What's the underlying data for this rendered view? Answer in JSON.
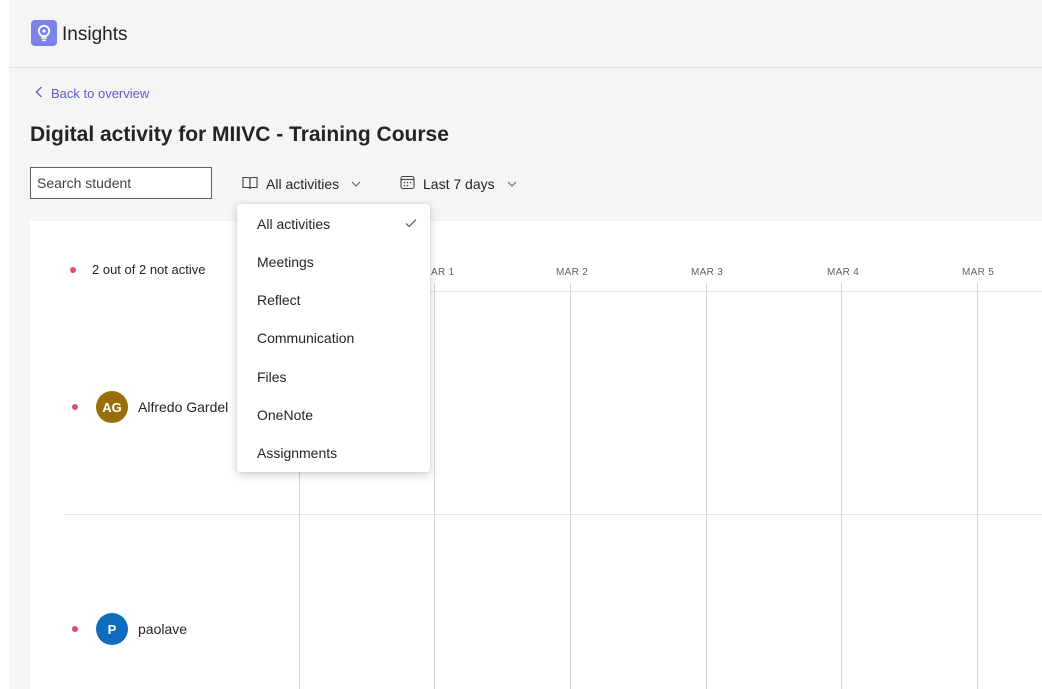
{
  "app": {
    "title": "Insights",
    "icon": "lightbulb-icon",
    "accent": "#7b83eb"
  },
  "nav": {
    "back_label": "Back to overview",
    "back_icon": "chevron-left-icon"
  },
  "page": {
    "title": "Digital activity for MIIVC - Training Course"
  },
  "filters": {
    "search_placeholder": "Search student",
    "activity": {
      "label": "All activities",
      "icon": "book-icon"
    },
    "date": {
      "label": "Last 7 days",
      "icon": "calendar-icon"
    }
  },
  "dropdown": {
    "items": [
      {
        "label": "All activities",
        "selected": true
      },
      {
        "label": "Meetings",
        "selected": false
      },
      {
        "label": "Reflect",
        "selected": false
      },
      {
        "label": "Communication",
        "selected": false
      },
      {
        "label": "Files",
        "selected": false
      },
      {
        "label": "OneNote",
        "selected": false
      },
      {
        "label": "Assignments",
        "selected": false
      }
    ]
  },
  "summary": {
    "text": "2 out of 2 not active"
  },
  "timeline": {
    "dates": [
      "AR 1",
      "MAR 2",
      "MAR 3",
      "MAR 4",
      "MAR 5"
    ]
  },
  "students": [
    {
      "name": "Alfredo Gardel",
      "initials": "AG",
      "avatar_color": "#986f0b",
      "status": "not active"
    },
    {
      "name": "paolave",
      "initials": "P",
      "avatar_color": "#0f6cbd",
      "status": "not active"
    }
  ],
  "colors": {
    "inactive_dot": "#e04f5f",
    "link": "#5b5fc7"
  }
}
